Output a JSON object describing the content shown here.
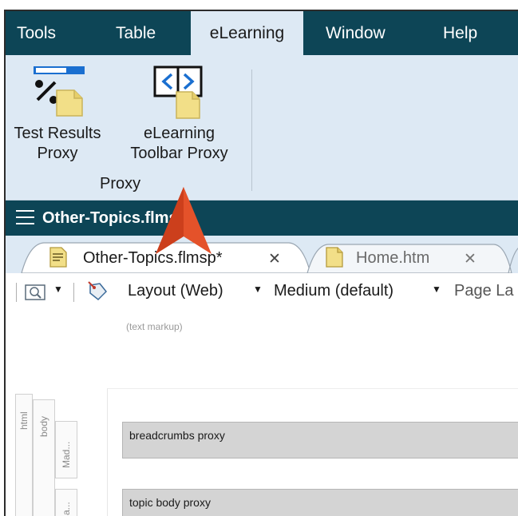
{
  "menu": {
    "items": [
      "Tools",
      "Table",
      "eLearning",
      "Window",
      "Help"
    ],
    "active": "eLearning"
  },
  "ribbon": {
    "test_results_proxy": "Test Results Proxy",
    "test_results_line1": "Test Results",
    "test_results_line2": "Proxy",
    "elearning_toolbar_line1": "eLearning",
    "elearning_toolbar_line2": "Toolbar Proxy",
    "group_label": "Proxy"
  },
  "document": {
    "title": "Other-Topics.flmsp*"
  },
  "tabs": [
    {
      "label": "Other-Topics.flmsp*",
      "active": true
    },
    {
      "label": "Home.htm",
      "active": false
    }
  ],
  "toolbar": {
    "layout": "Layout (Web)",
    "medium": "Medium (default)",
    "page_layout": "Page La"
  },
  "editor": {
    "markup_label": "(text markup)",
    "structure": [
      "html",
      "body",
      "Mad...",
      "Ma..."
    ],
    "proxies": [
      "breadcrumbs proxy",
      "topic body proxy"
    ]
  },
  "colors": {
    "menu_bg": "#0d4556",
    "ribbon_bg": "#dde9f4",
    "callout": "#e4522a"
  }
}
